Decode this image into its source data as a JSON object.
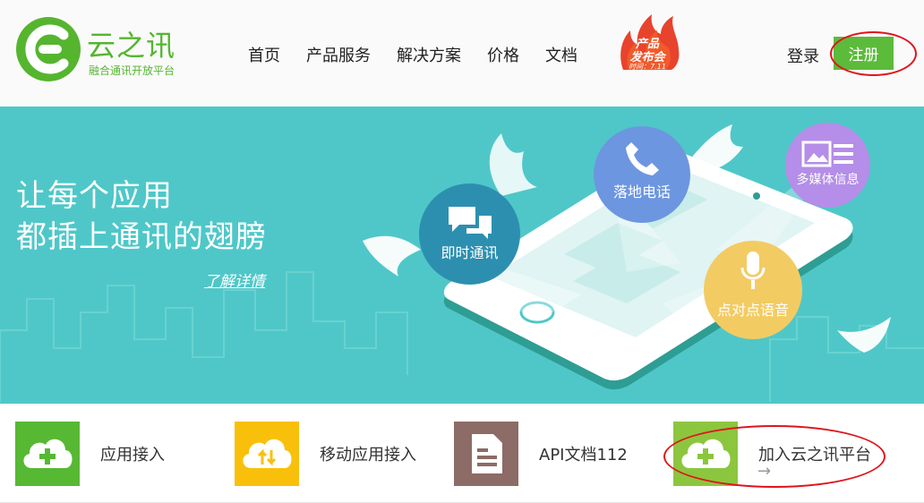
{
  "brand": {
    "name": "云之讯",
    "tagline": "融合通讯开放平台",
    "color": "#55b52f"
  },
  "nav": {
    "items": [
      {
        "label": "首页"
      },
      {
        "label": "产品服务"
      },
      {
        "label": "解决方案"
      },
      {
        "label": "价格"
      },
      {
        "label": "文档"
      }
    ]
  },
  "launch_badge": {
    "line1": "产品",
    "line2": "发布会",
    "date": "时间：7.11"
  },
  "auth": {
    "login": "登录",
    "register": "注册",
    "accent": "#5cbb3a"
  },
  "banner": {
    "background": "#4fc7c8",
    "headline_line1": "让每个应用",
    "headline_line2": "都插上通讯的翅膀",
    "details_link": "了解详情",
    "bubbles": [
      {
        "label": "即时通讯",
        "icon": "chat-icon",
        "color": "#2d8fb0"
      },
      {
        "label": "落地电话",
        "icon": "phone-icon",
        "color": "#6d96e0"
      },
      {
        "label": "多媒体信息",
        "icon": "media-icon",
        "color": "#b48ee8"
      },
      {
        "label": "点对点语音",
        "icon": "microphone-icon",
        "color": "#f3cb63"
      }
    ]
  },
  "features": [
    {
      "label": "应用接入",
      "icon": "cloud-plus-icon",
      "color": "#57b833"
    },
    {
      "label": "移动应用接入",
      "icon": "cloud-sync-icon",
      "color": "#f9c00b"
    },
    {
      "label": "API文档112",
      "icon": "document-icon",
      "color": "#8d6b66"
    },
    {
      "label": "加入云之讯平台",
      "icon": "cloud-plus-icon",
      "color": "#8cc63e"
    }
  ],
  "feature_arrow": "→"
}
